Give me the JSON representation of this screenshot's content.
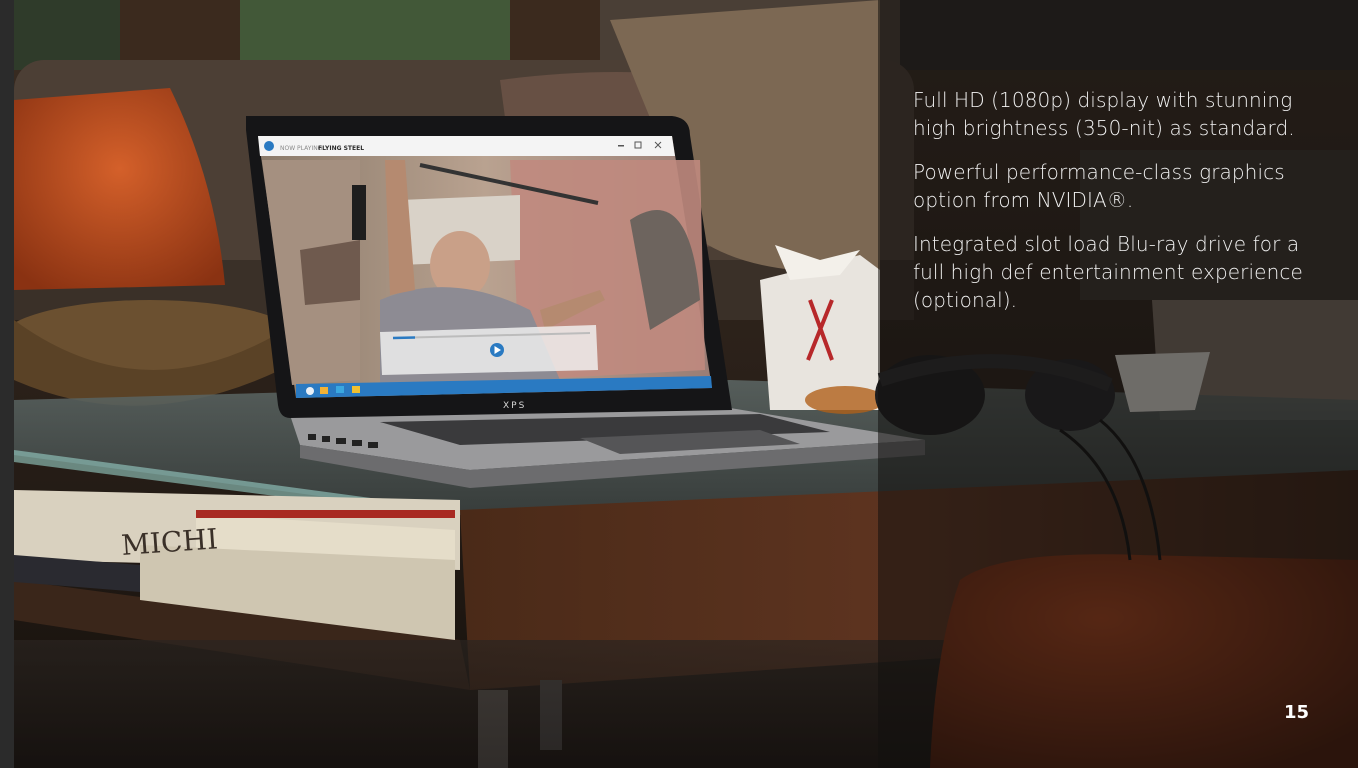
{
  "features": [
    "Full HD (1080p) display with stunning high brightness (350-nit) as standard.",
    "Powerful performance-class graphics option from NVIDIA®.",
    "Integrated slot load Blu-ray drive for a full high def entertainment experience (optional)."
  ],
  "page_number": "15",
  "laptop": {
    "brand": "XPS",
    "now_playing_prefix": "NOW PLAYING:",
    "now_playing_title": "FLYING STEEL"
  },
  "book_spine_text": "MICHI",
  "colors": {
    "panel_text": "#f2f2f2",
    "taskbar_blue": "#2a7ac2",
    "pillow_orange": "#c4521c"
  },
  "icons": [
    "minimize-icon",
    "maximize-icon",
    "close-icon",
    "play-icon"
  ]
}
